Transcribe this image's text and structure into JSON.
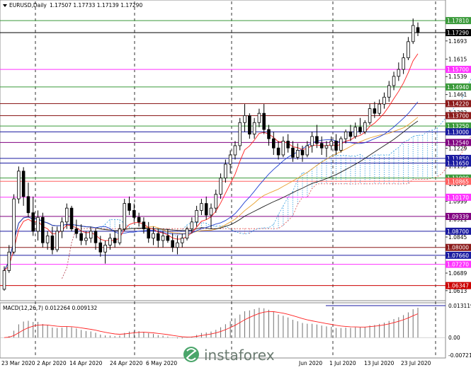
{
  "header": {
    "symbol": "EURUSD,Daily",
    "ohlc": "1.17507 1.17733 1.17139 1.17290"
  },
  "watermark": "instaforex",
  "chart_data": {
    "type": "candlestick",
    "title": "EURUSD,Daily",
    "ohlc_readout": {
      "open": 1.17507,
      "high": 1.17733,
      "low": 1.17139,
      "close": 1.1729
    },
    "price_axis_ticks": [
      1.1781,
      1.1693,
      1.1615,
      1.1539,
      1.1461,
      1.1383,
      1.1307,
      1.1229,
      1.1153,
      1.1075,
      1.0999,
      1.0921,
      1.0845,
      1.0767,
      1.0689,
      1.0613
    ],
    "price_range": [
      1.0585,
      1.1815
    ],
    "horizontal_levels": [
      {
        "price": 1.1781,
        "label": "1.17810",
        "color": "#3a9a3a"
      },
      {
        "price": 1.1729,
        "label": "1.17290",
        "color": "#000000"
      },
      {
        "price": 1.157,
        "label": "1.15700",
        "color": "#ff33ff"
      },
      {
        "price": 1.1494,
        "label": "1.14940",
        "color": "#3a9a3a"
      },
      {
        "price": 1.1422,
        "label": "1.14220",
        "color": "#8b1a1a"
      },
      {
        "price": 1.137,
        "label": "1.13700",
        "color": "#8b1a1a"
      },
      {
        "price": 1.1325,
        "label": "1.13250",
        "color": "#3a9a3a"
      },
      {
        "price": 1.13,
        "label": "1.13000",
        "color": "#1a1aa0"
      },
      {
        "price": 1.1254,
        "label": "1.12540",
        "color": "#800080"
      },
      {
        "price": 1.1185,
        "label": "1.11850",
        "color": "#1a1aa0"
      },
      {
        "price": 1.1165,
        "label": "1.11650",
        "color": "#1a1aa0"
      },
      {
        "price": 1.11,
        "label": "1.11000",
        "color": "#3a9a3a"
      },
      {
        "price": 1.1086,
        "label": "1.10865",
        "color": "#ff6060"
      },
      {
        "price": 1.1017,
        "label": "1.10170",
        "color": "#ff33ff"
      },
      {
        "price": 1.0934,
        "label": "1.09339",
        "color": "#800080"
      },
      {
        "price": 1.087,
        "label": "1.08700",
        "color": "#1a1aa0"
      },
      {
        "price": 1.08,
        "label": "1.08000",
        "color": "#8b1a1a"
      },
      {
        "price": 1.0766,
        "label": "1.07660",
        "color": "#1a1aa0"
      },
      {
        "price": 1.0727,
        "label": "1.07270",
        "color": "#ff33ff"
      },
      {
        "price": 1.0635,
        "label": "1.06347",
        "color": "#cc0000"
      }
    ],
    "date_labels": [
      "23 Mar 2020",
      "2 Apr 2020",
      "14 Apr 2020",
      "24 Apr 2020",
      "6 May 2020",
      "Jun 2020",
      "1 Jul 2020",
      "13 Jul 2020",
      "23 Jul 2020"
    ],
    "candles": [
      [
        1.0619,
        1.0718,
        1.0613,
        1.07
      ],
      [
        1.07,
        1.081,
        1.069,
        1.078
      ],
      [
        1.078,
        1.103,
        1.077,
        1.101
      ],
      [
        1.101,
        1.115,
        1.099,
        1.113
      ],
      [
        1.113,
        1.1147,
        1.098,
        1.102
      ],
      [
        1.102,
        1.108,
        1.093,
        1.095
      ],
      [
        1.095,
        1.102,
        1.085,
        1.087
      ],
      [
        1.087,
        1.096,
        1.083,
        1.093
      ],
      [
        1.093,
        1.095,
        1.08,
        1.082
      ],
      [
        1.082,
        1.087,
        1.079,
        1.085
      ],
      [
        1.085,
        1.089,
        1.077,
        1.079
      ],
      [
        1.079,
        1.089,
        1.078,
        1.087
      ],
      [
        1.087,
        1.093,
        1.084,
        1.091
      ],
      [
        1.091,
        1.099,
        1.088,
        1.097
      ],
      [
        1.097,
        1.098,
        1.087,
        1.088
      ],
      [
        1.088,
        1.092,
        1.084,
        1.086
      ],
      [
        1.086,
        1.09,
        1.081,
        1.083
      ],
      [
        1.083,
        1.087,
        1.081,
        1.084
      ],
      [
        1.084,
        1.089,
        1.082,
        1.087
      ],
      [
        1.087,
        1.088,
        1.079,
        1.082
      ],
      [
        1.082,
        1.085,
        1.076,
        1.078
      ],
      [
        1.078,
        1.083,
        1.073,
        1.081
      ],
      [
        1.081,
        1.086,
        1.079,
        1.084
      ],
      [
        1.084,
        1.087,
        1.08,
        1.082
      ],
      [
        1.082,
        1.09,
        1.081,
        1.088
      ],
      [
        1.088,
        1.101,
        1.087,
        1.099
      ],
      [
        1.099,
        1.102,
        1.094,
        1.096
      ],
      [
        1.096,
        1.099,
        1.091,
        1.093
      ],
      [
        1.093,
        1.095,
        1.089,
        1.091
      ],
      [
        1.091,
        1.093,
        1.086,
        1.088
      ],
      [
        1.088,
        1.091,
        1.082,
        1.084
      ],
      [
        1.084,
        1.089,
        1.081,
        1.086
      ],
      [
        1.086,
        1.088,
        1.08,
        1.083
      ],
      [
        1.083,
        1.087,
        1.08,
        1.085
      ],
      [
        1.085,
        1.088,
        1.082,
        1.083
      ],
      [
        1.083,
        1.086,
        1.078,
        1.08
      ],
      [
        1.08,
        1.085,
        1.077,
        1.082
      ],
      [
        1.082,
        1.086,
        1.08,
        1.084
      ],
      [
        1.084,
        1.089,
        1.083,
        1.088
      ],
      [
        1.088,
        1.093,
        1.086,
        1.091
      ],
      [
        1.091,
        1.098,
        1.089,
        1.096
      ],
      [
        1.096,
        1.101,
        1.094,
        1.099
      ],
      [
        1.099,
        1.102,
        1.092,
        1.094
      ],
      [
        1.094,
        1.099,
        1.088,
        1.097
      ],
      [
        1.097,
        1.105,
        1.095,
        1.103
      ],
      [
        1.103,
        1.112,
        1.101,
        1.11
      ],
      [
        1.11,
        1.118,
        1.108,
        1.116
      ],
      [
        1.116,
        1.122,
        1.112,
        1.12
      ],
      [
        1.12,
        1.126,
        1.118,
        1.124
      ],
      [
        1.124,
        1.136,
        1.122,
        1.134
      ],
      [
        1.134,
        1.142,
        1.13,
        1.137
      ],
      [
        1.137,
        1.138,
        1.127,
        1.129
      ],
      [
        1.129,
        1.136,
        1.127,
        1.134
      ],
      [
        1.134,
        1.14,
        1.132,
        1.138
      ],
      [
        1.138,
        1.142,
        1.129,
        1.131
      ],
      [
        1.131,
        1.133,
        1.124,
        1.127
      ],
      [
        1.127,
        1.13,
        1.12,
        1.123
      ],
      [
        1.123,
        1.126,
        1.118,
        1.12
      ],
      [
        1.12,
        1.128,
        1.119,
        1.126
      ],
      [
        1.126,
        1.129,
        1.121,
        1.123
      ],
      [
        1.123,
        1.126,
        1.117,
        1.119
      ],
      [
        1.119,
        1.125,
        1.118,
        1.122
      ],
      [
        1.122,
        1.124,
        1.117,
        1.12
      ],
      [
        1.12,
        1.126,
        1.119,
        1.124
      ],
      [
        1.124,
        1.13,
        1.121,
        1.128
      ],
      [
        1.128,
        1.133,
        1.123,
        1.125
      ],
      [
        1.125,
        1.128,
        1.12,
        1.123
      ],
      [
        1.123,
        1.126,
        1.119,
        1.124
      ],
      [
        1.124,
        1.128,
        1.122,
        1.126
      ],
      [
        1.126,
        1.129,
        1.12,
        1.122
      ],
      [
        1.122,
        1.128,
        1.121,
        1.127
      ],
      [
        1.127,
        1.131,
        1.125,
        1.13
      ],
      [
        1.13,
        1.133,
        1.126,
        1.128
      ],
      [
        1.128,
        1.134,
        1.127,
        1.132
      ],
      [
        1.132,
        1.136,
        1.129,
        1.13
      ],
      [
        1.13,
        1.135,
        1.129,
        1.134
      ],
      [
        1.134,
        1.142,
        1.133,
        1.14
      ],
      [
        1.14,
        1.143,
        1.136,
        1.138
      ],
      [
        1.138,
        1.144,
        1.137,
        1.142
      ],
      [
        1.142,
        1.147,
        1.14,
        1.145
      ],
      [
        1.145,
        1.152,
        1.143,
        1.15
      ],
      [
        1.15,
        1.156,
        1.148,
        1.154
      ],
      [
        1.154,
        1.16,
        1.152,
        1.157
      ],
      [
        1.157,
        1.164,
        1.155,
        1.162
      ],
      [
        1.162,
        1.171,
        1.161,
        1.169
      ],
      [
        1.169,
        1.179,
        1.168,
        1.176
      ],
      [
        1.1751,
        1.1773,
        1.1714,
        1.1729
      ]
    ],
    "macd": {
      "label": "MACD(12,26,7) 0.012264 0.009132",
      "params": [
        12,
        26,
        7
      ],
      "main": 0.012264,
      "signal": 0.009132,
      "axis_ticks": [
        0.013119,
        0.0,
        -0.007213
      ],
      "axis_labels": [
        "0.013119",
        "0.00",
        "-0.007213"
      ]
    }
  }
}
